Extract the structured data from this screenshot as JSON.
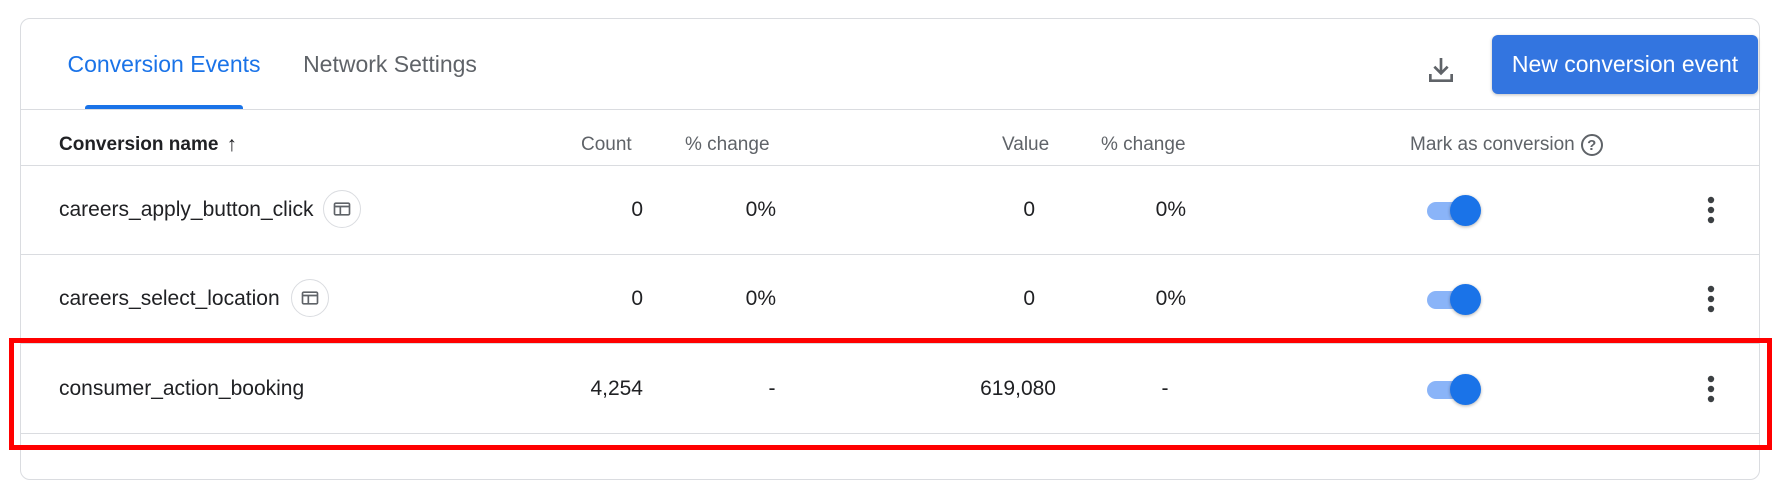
{
  "tabs": [
    {
      "label": "Conversion Events",
      "active": true
    },
    {
      "label": "Network Settings",
      "active": false
    }
  ],
  "toolbar": {
    "download_icon": "download-icon",
    "new_button_label": "New conversion event"
  },
  "table": {
    "headers": {
      "name": "Conversion name",
      "sort_icon": "↑",
      "count": "Count",
      "count_change": "% change",
      "value": "Value",
      "value_change": "% change",
      "mark": "Mark as conversion",
      "help": "?"
    },
    "rows": [
      {
        "name": "careers_apply_button_click",
        "count": "0",
        "count_change": "0%",
        "value": "0",
        "value_change": "0%",
        "marked": true,
        "has_web_icon": true
      },
      {
        "name": "careers_select_location",
        "count": "0",
        "count_change": "0%",
        "value": "0",
        "value_change": "0%",
        "marked": true,
        "has_web_icon": true
      },
      {
        "name": "consumer_action_booking",
        "count": "4,254",
        "count_change": "-",
        "value": "619,080",
        "value_change": "-",
        "marked": true,
        "has_web_icon": false
      }
    ]
  },
  "colors": {
    "accent": "#1a73e8",
    "button": "#3375e0",
    "toggle_track": "#8ab4f8",
    "highlight": "#ff0000"
  }
}
